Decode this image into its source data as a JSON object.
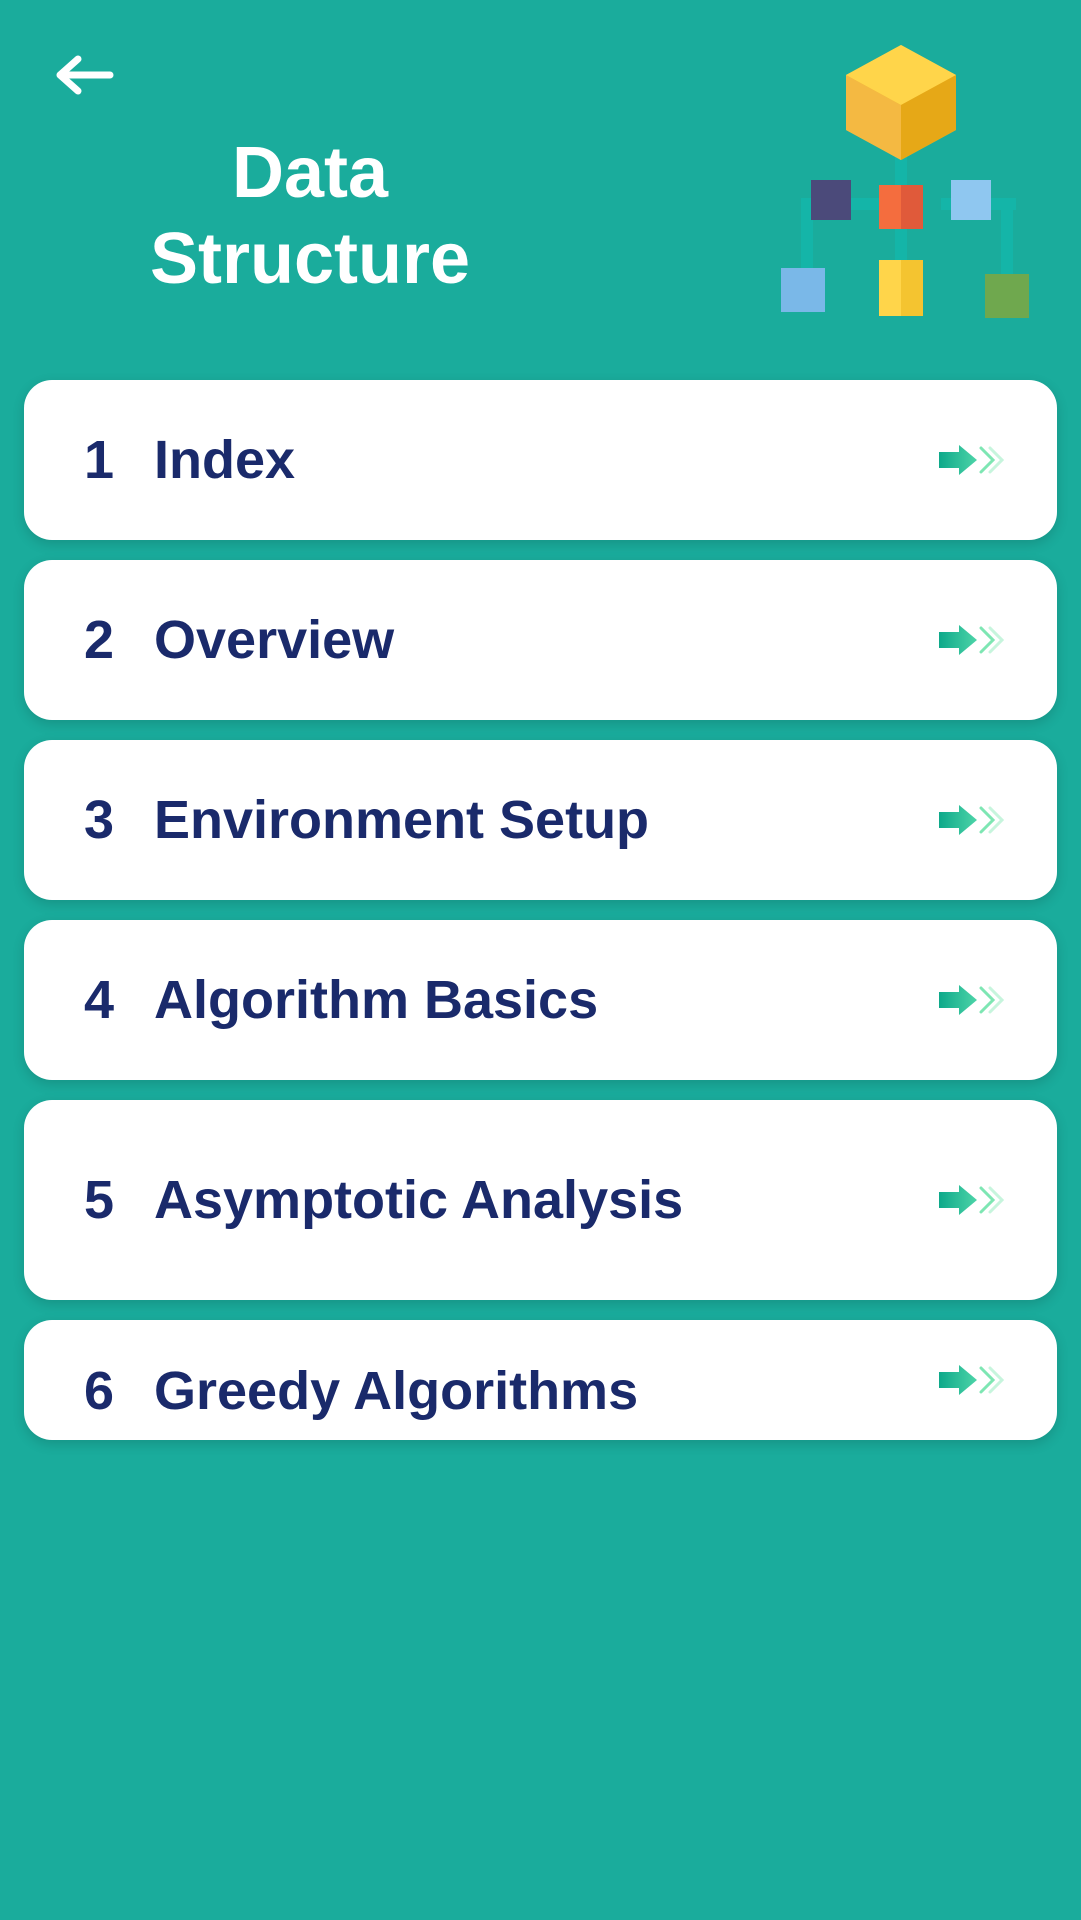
{
  "header": {
    "title": "Data Structure"
  },
  "topics": [
    {
      "number": "1",
      "title": "Index",
      "multiline": false
    },
    {
      "number": "2",
      "title": "Overview",
      "multiline": false
    },
    {
      "number": "3",
      "title": "Environment Setup",
      "multiline": false
    },
    {
      "number": "4",
      "title": "Algorithm Basics",
      "multiline": false
    },
    {
      "number": "5",
      "title": "Asymptotic Analysis",
      "multiline": true
    },
    {
      "number": "6",
      "title": "Greedy Algorithms",
      "multiline": false
    }
  ],
  "colors": {
    "background": "#1aac9c",
    "cardBg": "#ffffff",
    "textPrimary": "#1a2a6b",
    "arrowGradientStart": "#15c39a",
    "arrowGradientEnd": "#7ee6b3",
    "chevron": "#7ee6b3"
  }
}
